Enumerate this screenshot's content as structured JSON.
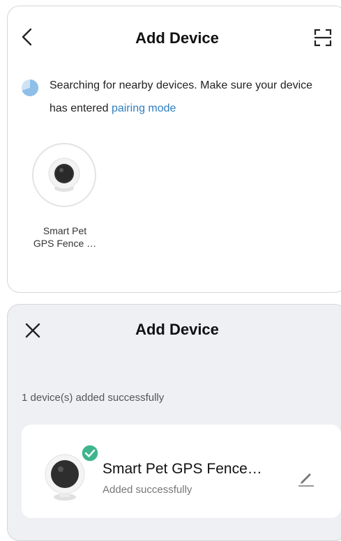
{
  "screen1": {
    "header": {
      "title": "Add Device",
      "back_icon": "back-chevron-icon",
      "scan_icon": "scan-icon"
    },
    "search": {
      "line1": "Searching for nearby devices. Make sure your device",
      "line2_prefix": "has entered ",
      "link": "pairing mode",
      "icon": "searching-spinner-icon"
    },
    "found_devices": [
      {
        "name_line1": "Smart Pet",
        "name_line2": "GPS Fence …",
        "icon": "camera-icon"
      }
    ]
  },
  "screen2": {
    "header": {
      "title": "Add Device",
      "close_icon": "close-icon"
    },
    "added_count_text": "1 device(s) added successfully",
    "device": {
      "name": "Smart Pet GPS Fence…",
      "status": "Added successfully",
      "icon": "camera-icon",
      "badge_icon": "check-badge-icon",
      "edit_icon": "edit-pencil-icon"
    }
  },
  "colors": {
    "link": "#2f7fc1",
    "success": "#3fb58e",
    "spinner": "#a9cdee"
  }
}
